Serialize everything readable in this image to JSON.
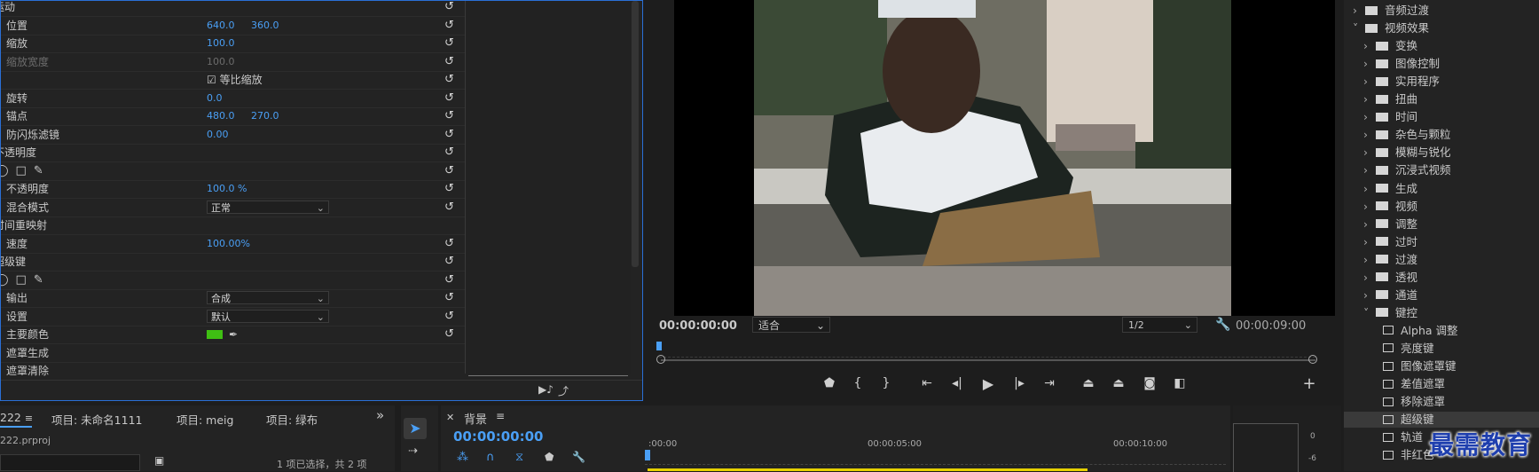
{
  "effect_controls": {
    "rows": [
      {
        "label": "运动",
        "type": "section"
      },
      {
        "label": "位置",
        "v1": "640.0",
        "v2": "360.0"
      },
      {
        "label": "缩放",
        "v1": "100.0"
      },
      {
        "label": "缩放宽度",
        "v1": "100.0",
        "disabled": true
      },
      {
        "label": "",
        "checkbox": "等比缩放"
      },
      {
        "label": "旋转",
        "v1": "0.0"
      },
      {
        "label": "锚点",
        "v1": "480.0",
        "v2": "270.0"
      },
      {
        "label": "防闪烁滤镜",
        "v1": "0.00"
      },
      {
        "label": "不透明度",
        "type": "section"
      },
      {
        "label": "",
        "shapes": true
      },
      {
        "label": "不透明度",
        "v1": "100.0 %"
      },
      {
        "label": "混合模式",
        "dropdown": "正常"
      },
      {
        "label": "时间重映射",
        "type": "section"
      },
      {
        "label": "速度",
        "v1": "100.00%"
      },
      {
        "label": "超级键",
        "type": "section"
      },
      {
        "label": "",
        "shapes": true
      },
      {
        "label": "输出",
        "dropdown": "合成"
      },
      {
        "label": "设置",
        "dropdown": "默认"
      },
      {
        "label": "主要颜色",
        "color": "#3fbf13"
      },
      {
        "label": "遮罩生成"
      },
      {
        "label": "遮罩清除"
      }
    ]
  },
  "program_monitor": {
    "timecode_left": "00:00:00:00",
    "fit_label": "适合",
    "resolution": "1/2",
    "timecode_right": "00:00:09:00"
  },
  "effects_tree": {
    "items": [
      {
        "label": "音频过渡",
        "level": 0,
        "arrow": "›"
      },
      {
        "label": "视频效果",
        "level": 0,
        "arrow": "˅"
      },
      {
        "label": "变换",
        "level": 1,
        "arrow": "›"
      },
      {
        "label": "图像控制",
        "level": 1,
        "arrow": "›"
      },
      {
        "label": "实用程序",
        "level": 1,
        "arrow": "›"
      },
      {
        "label": "扭曲",
        "level": 1,
        "arrow": "›"
      },
      {
        "label": "时间",
        "level": 1,
        "arrow": "›"
      },
      {
        "label": "杂色与颗粒",
        "level": 1,
        "arrow": "›"
      },
      {
        "label": "模糊与锐化",
        "level": 1,
        "arrow": "›"
      },
      {
        "label": "沉浸式视频",
        "level": 1,
        "arrow": "›"
      },
      {
        "label": "生成",
        "level": 1,
        "arrow": "›"
      },
      {
        "label": "视频",
        "level": 1,
        "arrow": "›"
      },
      {
        "label": "调整",
        "level": 1,
        "arrow": "›"
      },
      {
        "label": "过时",
        "level": 1,
        "arrow": "›"
      },
      {
        "label": "过渡",
        "level": 1,
        "arrow": "›"
      },
      {
        "label": "透视",
        "level": 1,
        "arrow": "›"
      },
      {
        "label": "通道",
        "level": 1,
        "arrow": "›"
      },
      {
        "label": "键控",
        "level": 1,
        "arrow": "˅"
      },
      {
        "label": "Alpha 调整",
        "level": 2
      },
      {
        "label": "亮度键",
        "level": 2
      },
      {
        "label": "图像遮罩键",
        "level": 2
      },
      {
        "label": "差值遮罩",
        "level": 2
      },
      {
        "label": "移除遮罩",
        "level": 2
      },
      {
        "label": "超级键",
        "level": 2,
        "selected": true
      },
      {
        "label": "轨道",
        "level": 2
      },
      {
        "label": "非红色",
        "level": 2
      }
    ]
  },
  "project_panel": {
    "tabs": [
      "222",
      "项目: 未命名1111",
      "项目: meig",
      "项目: 绿布"
    ],
    "file": "222.prproj",
    "status": "1 项已选择，共 2 项"
  },
  "timeline": {
    "sequence_tab": "背景",
    "timecode": "00:00:00:00",
    "ruler": [
      ":00:00",
      "00:00:05:00",
      "00:00:10:00"
    ]
  },
  "watermark": "最需教育"
}
